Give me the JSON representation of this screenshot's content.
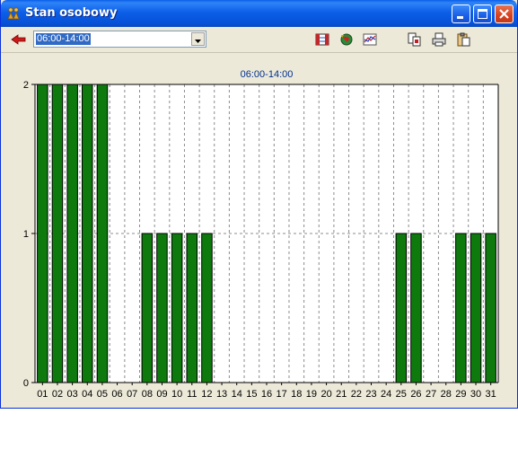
{
  "window": {
    "title": "Stan osobowy",
    "icon": "app-icon"
  },
  "window_buttons": [
    "minimize-icon",
    "maximize-icon",
    "close-icon"
  ],
  "toolbar": {
    "back_icon": "red-arrow-left-icon",
    "shift_select": {
      "value": "06:00-14:00"
    },
    "icons_group1": [
      "calendar-grid-icon",
      "globe-refresh-icon",
      "chart-lines-icon"
    ],
    "icons_group2": [
      "export-icon",
      "print-icon",
      "copy-clipboard-icon"
    ]
  },
  "colors": {
    "bar_fill": "#0e7a0e",
    "bar_stroke": "#000000",
    "title_text": "#00308f",
    "accent": "#316ac5"
  },
  "chart_data": {
    "type": "bar",
    "title": "06:00-14:00",
    "categories": [
      "01",
      "02",
      "03",
      "04",
      "05",
      "06",
      "07",
      "08",
      "09",
      "10",
      "11",
      "12",
      "13",
      "14",
      "15",
      "16",
      "17",
      "18",
      "19",
      "20",
      "21",
      "22",
      "23",
      "24",
      "25",
      "26",
      "27",
      "28",
      "29",
      "30",
      "31"
    ],
    "values": [
      2,
      2,
      2,
      2,
      2,
      0,
      0,
      1,
      1,
      1,
      1,
      1,
      0,
      0,
      0,
      0,
      0,
      0,
      0,
      0,
      0,
      0,
      0,
      0,
      1,
      1,
      0,
      0,
      1,
      1,
      1
    ],
    "yticks": [
      0,
      1,
      2
    ],
    "ylim": [
      0,
      2
    ],
    "grid": true,
    "legend": "none"
  }
}
